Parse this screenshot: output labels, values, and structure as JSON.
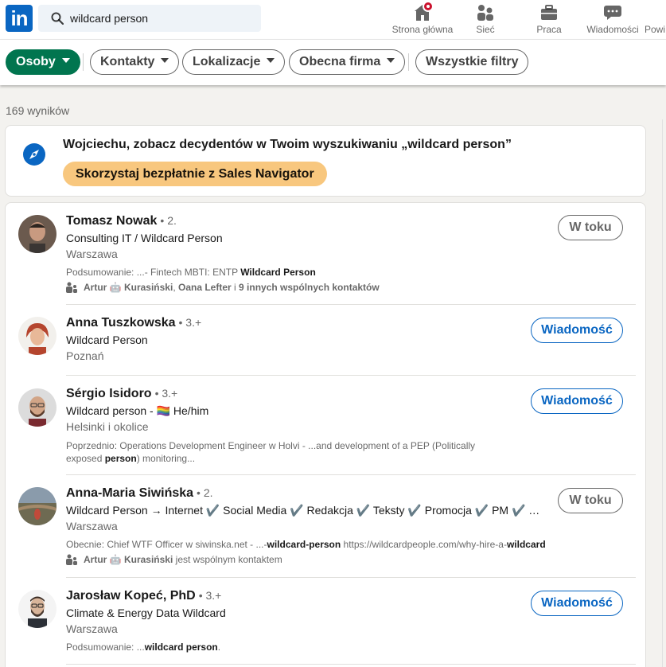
{
  "nav": {
    "logo": "in",
    "search_value": "wildcard person",
    "items": [
      {
        "label": "Strona główna",
        "icon": "home-icon"
      },
      {
        "label": "Sieć",
        "icon": "network-icon"
      },
      {
        "label": "Praca",
        "icon": "briefcase-icon"
      },
      {
        "label": "Wiadomości",
        "icon": "messaging-icon"
      },
      {
        "label": "Powi",
        "icon": "notifications-icon"
      }
    ]
  },
  "filters": {
    "active": "Osoby",
    "items": [
      "Kontakty",
      "Lokalizacje",
      "Obecna firma"
    ],
    "all_filters": "Wszystkie filtry"
  },
  "results_count": "169 wyników",
  "promo": {
    "text": "Wojciechu, zobacz decydentów w Twoim wyszukiwaniu „wildcard person”",
    "button": "Skorzystaj bezpłatnie z Sales Navigator"
  },
  "results": [
    {
      "name": "Tomasz Nowak",
      "degree": "• 2.",
      "headline": "Consulting IT / Wildcard Person",
      "location": "Warszawa",
      "snippet_prefix": "Podsumowanie: ...- Fintech MBTI: ENTP ",
      "snippet_bold": "Wildcard Person",
      "snippet_suffix": "",
      "mutual_a": "Artur 🤖 Kurasiński",
      "mutual_sep": ", ",
      "mutual_b": "Oana Lefter",
      "mutual_mid": " i ",
      "mutual_c": "9 innych wspólnych kontaktów",
      "action": "W toku"
    },
    {
      "name": "Anna Tuszkowska",
      "degree": "• 3.+",
      "headline": "Wildcard Person",
      "location": "Poznań",
      "action": "Wiadomość"
    },
    {
      "name": "Sérgio Isidoro",
      "degree": "• 3.+",
      "headline": "Wildcard person - 🏳️‍🌈 He/him",
      "location": "Helsinki i okolice",
      "snippet_line1": "Poprzednio: Operations Development Engineer w Holvi - ...and development of a PEP (Politically",
      "snippet_line2_prefix": "exposed ",
      "snippet_line2_bold": "person",
      "snippet_line2_suffix": ") monitoring...",
      "action": "Wiadomość"
    },
    {
      "name": "Anna-Maria Siwińska",
      "degree": "• 2.",
      "headline": "Wildcard Person → Internet ✔️ Social Media ✔️ Redakcja ✔️ Teksty ✔️ Promocja ✔️ PM ✔️ UX ✔️ Wildcard",
      "location": "Warszawa",
      "snippet_prefix": "Obecnie: Chief WTF Officer w siwinska.net - ...-",
      "snippet_bold": "wildcard-person",
      "snippet_mid": " https://wildcardpeople.com/why-hire-a-",
      "snippet_bold2": "wildcard",
      "mutual_a": "Artur 🤖 Kurasiński",
      "mutual_rest": " jest wspólnym kontaktem",
      "action": "W toku"
    },
    {
      "name": "Jarosław Kopeć, PhD",
      "degree": "• 3.+",
      "headline": "Climate & Energy Data Wildcard",
      "location": "Warszawa",
      "snippet_prefix": "Podsumowanie: ...",
      "snippet_bold": "wildcard person",
      "snippet_suffix": ".",
      "action": "Wiadomość"
    }
  ],
  "colors": {
    "brand": "#0a66c2",
    "active_filter": "#01754f",
    "promo_button": "#f8c77e",
    "notification": "#cb112d"
  }
}
